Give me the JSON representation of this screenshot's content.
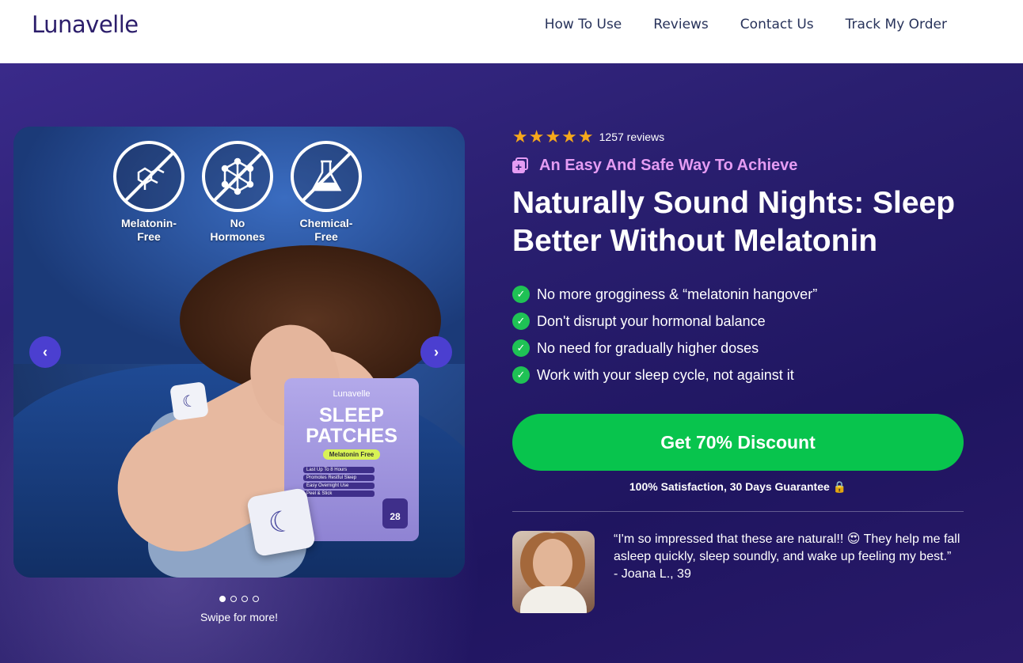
{
  "header": {
    "logo": "Lunavelle",
    "nav": [
      "How To Use",
      "Reviews",
      "Contact Us",
      "Track My Order"
    ]
  },
  "carousel": {
    "badges": [
      {
        "label": "Melatonin-\nFree",
        "icon": "molecule-icon"
      },
      {
        "label": "No\nHormones",
        "icon": "hexagon-network-icon"
      },
      {
        "label": "Chemical-\nFree",
        "icon": "flask-icon"
      }
    ],
    "product": {
      "brand": "Lunavelle",
      "title_line1": "SLEEP",
      "title_line2": "PATCHES",
      "tag": "Melatonin Free",
      "features": [
        "Last Up To 8 Hours",
        "Promotes Restful Sleep",
        "Easy Overnight Use",
        "Peel & Stick"
      ],
      "count": "28"
    },
    "prev_icon": "‹",
    "next_icon": "›",
    "dots_total": 4,
    "dots_active": 1,
    "swipe_text": "Swipe for more!"
  },
  "hero": {
    "rating_stars": 5,
    "stars_text": "★★★★★",
    "reviews_text": "1257 reviews",
    "kicker": "An Easy And Safe Way To Achieve",
    "headline": "Naturally Sound Nights: Sleep Better Without Melatonin",
    "benefits": [
      "No more grogginess & “melatonin hangover”",
      "Don't disrupt your hormonal balance",
      "No need for gradually higher doses",
      "Work with your sleep cycle, not against it"
    ],
    "cta": "Get 70% Discount",
    "guarantee": "100% Satisfaction, 30 Days Guarantee 🔒",
    "testimonial": {
      "quote": "“I'm so impressed that these are natural!! 😍 They help me fall asleep quickly, sleep soundly, and wake up feeling my best.”",
      "author": "- Joana L., 39"
    }
  },
  "colors": {
    "hero_bg": "#2a1f70",
    "accent_pink": "#e59cf3",
    "cta_green": "#08c44d",
    "star": "#f6a81c",
    "arrow": "#4b3fd0"
  }
}
